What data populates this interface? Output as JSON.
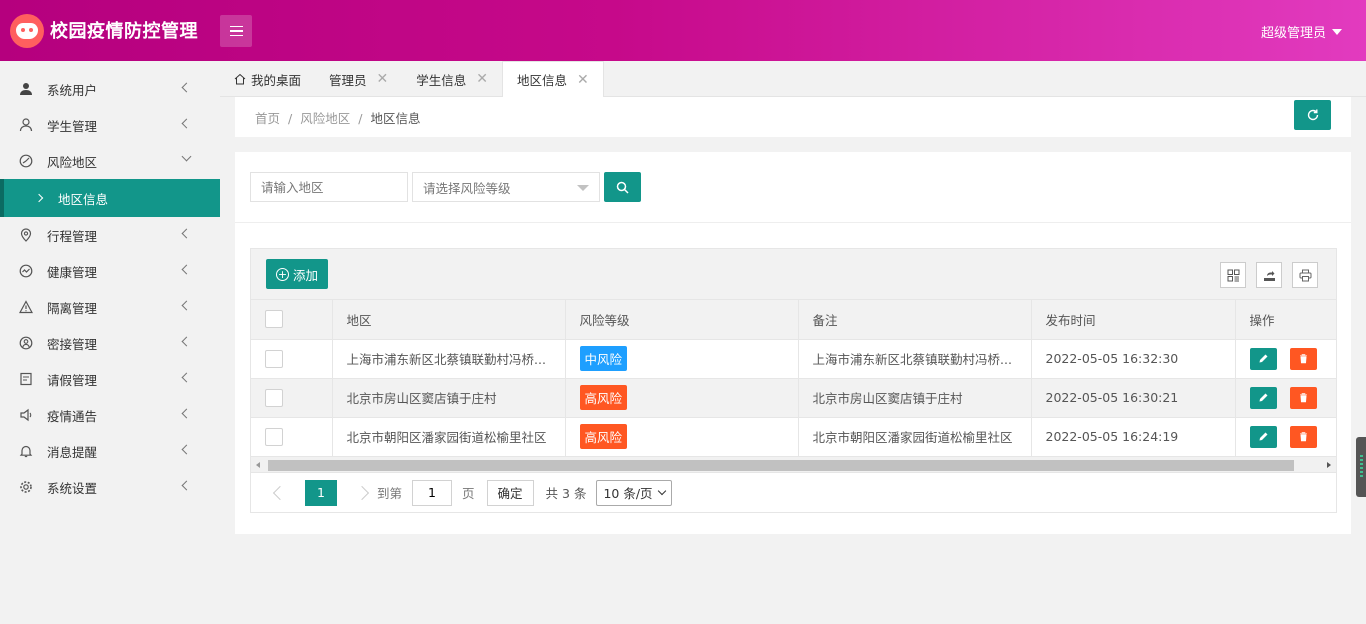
{
  "header": {
    "app_title": "校园疫情防控管理",
    "user_label": "超级管理员"
  },
  "sidebar": {
    "items": [
      {
        "label": "系统用户",
        "icon": "user-icon"
      },
      {
        "label": "学生管理",
        "icon": "user-outline-icon"
      },
      {
        "label": "风险地区",
        "icon": "risk-map-icon",
        "expanded": true
      },
      {
        "label": "行程管理",
        "icon": "location-pin-icon"
      },
      {
        "label": "健康管理",
        "icon": "health-chart-icon"
      },
      {
        "label": "隔离管理",
        "icon": "warning-triangle-icon"
      },
      {
        "label": "密接管理",
        "icon": "contact-person-icon"
      },
      {
        "label": "请假管理",
        "icon": "leave-form-icon"
      },
      {
        "label": "疫情通告",
        "icon": "speaker-icon"
      },
      {
        "label": "消息提醒",
        "icon": "bell-icon"
      },
      {
        "label": "系统设置",
        "icon": "gear-icon"
      }
    ],
    "sub_item": {
      "label": "地区信息"
    }
  },
  "tabs": [
    {
      "label": "我的桌面",
      "icon": "home-icon"
    },
    {
      "label": "管理员"
    },
    {
      "label": "学生信息"
    },
    {
      "label": "地区信息",
      "active": true
    }
  ],
  "breadcrumb": {
    "items": [
      "首页",
      "风险地区",
      "地区信息"
    ]
  },
  "search": {
    "region_placeholder": "请输入地区",
    "risk_placeholder": "请选择风险等级"
  },
  "toolbar": {
    "add_label": "添加"
  },
  "table": {
    "columns": [
      "地区",
      "风险等级",
      "备注",
      "发布时间",
      "操作"
    ],
    "rows": [
      {
        "region": "上海市浦东新区北蔡镇联勤村冯桥...",
        "risk": "中风险",
        "risk_color": "#1e9fff",
        "note": "上海市浦东新区北蔡镇联勤村冯桥...",
        "time": "2022-05-05 16:32:30"
      },
      {
        "region": "北京市房山区窦店镇于庄村",
        "risk": "高风险",
        "risk_color": "#ff5722",
        "note": "北京市房山区窦店镇于庄村",
        "time": "2022-05-05 16:30:21"
      },
      {
        "region": "北京市朝阳区潘家园街道松榆里社区",
        "risk": "高风险",
        "risk_color": "#ff5722",
        "note": "北京市朝阳区潘家园街道松榆里社区",
        "time": "2022-05-05 16:24:19"
      }
    ]
  },
  "pager": {
    "current_page": "1",
    "goto_label": "到第",
    "page_input": "1",
    "page_unit": "页",
    "confirm_label": "确定",
    "total_label": "共 3 条",
    "page_size": "10 条/页"
  },
  "colors": {
    "primary": "#12968a",
    "header_start": "#b5007e",
    "header_end": "#e23bbf",
    "danger": "#ff5722",
    "info": "#1e9fff"
  }
}
